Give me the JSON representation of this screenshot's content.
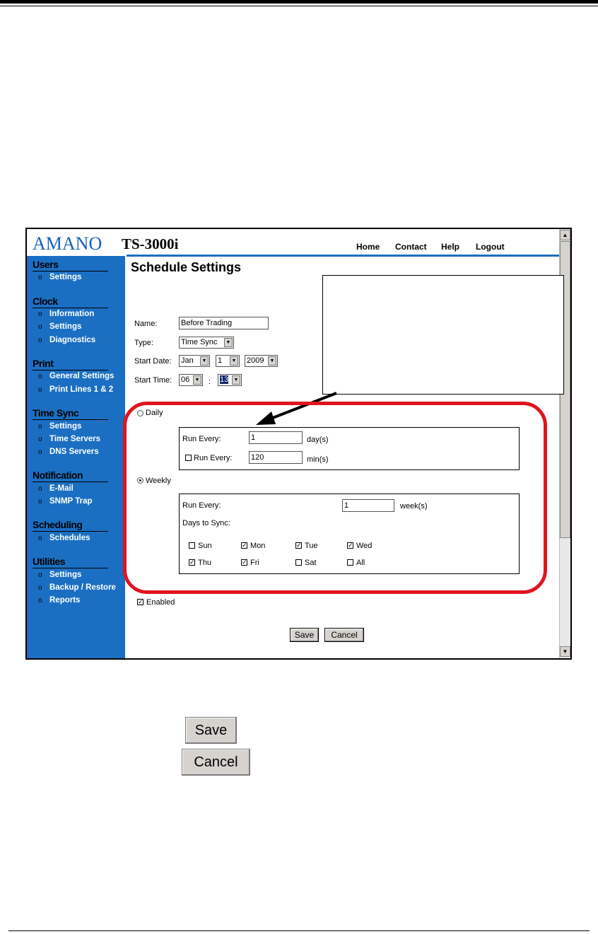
{
  "header": {
    "logo": "AMANO",
    "model": "TS-3000i",
    "nav": [
      "Home",
      "Contact",
      "Help",
      "Logout"
    ]
  },
  "sidebar": {
    "sections": [
      {
        "title": "Users",
        "items": [
          "Settings"
        ]
      },
      {
        "title": "Clock",
        "items": [
          "Information",
          "Settings",
          "Diagnostics"
        ]
      },
      {
        "title": "Print",
        "items": [
          "General Settings",
          "Print Lines 1 & 2"
        ]
      },
      {
        "title": "Time Sync",
        "items": [
          "Settings",
          "Time Servers",
          "DNS Servers"
        ]
      },
      {
        "title": "Notification",
        "items": [
          "E-Mail",
          "SNMP Trap"
        ]
      },
      {
        "title": "Scheduling",
        "items": [
          "Schedules"
        ]
      },
      {
        "title": "Utilities",
        "items": [
          "Settings",
          "Backup / Restore",
          "Reports"
        ]
      }
    ],
    "bullet": "o"
  },
  "page": {
    "title": "Schedule Settings",
    "name_label": "Name:",
    "name_value": "Before Trading",
    "type_label": "Type:",
    "type_value": "Time Sync",
    "start_date_label": "Start Date:",
    "start_month": "Jan",
    "start_day": "1",
    "start_year": "2009",
    "start_time_label": "Start Time:",
    "start_hour": "06",
    "time_sep": ":",
    "start_minute": "13"
  },
  "daily": {
    "label": "Daily",
    "selected": false,
    "run_every_label": "Run Every:",
    "run_every_value": "1",
    "run_every_unit": "day(s)",
    "run_every2_label": "Run Every:",
    "run_every2_checked": false,
    "run_every2_value": "120",
    "run_every2_unit": "min(s)"
  },
  "weekly": {
    "label": "Weekly",
    "selected": true,
    "run_every_label": "Run Every:",
    "run_every_value": "1",
    "run_every_unit": "week(s)",
    "days_label": "Days to Sync:",
    "days": [
      {
        "label": "Sun",
        "checked": false
      },
      {
        "label": "Mon",
        "checked": true
      },
      {
        "label": "Tue",
        "checked": true
      },
      {
        "label": "Wed",
        "checked": true
      },
      {
        "label": "Thu",
        "checked": true
      },
      {
        "label": "Fri",
        "checked": true
      },
      {
        "label": "Sat",
        "checked": false
      },
      {
        "label": "All",
        "checked": false
      }
    ]
  },
  "enabled": {
    "label": "Enabled",
    "checked": true
  },
  "buttons": {
    "save": "Save",
    "cancel": "Cancel"
  },
  "legend_buttons": {
    "save": "Save",
    "cancel": "Cancel"
  },
  "colors": {
    "brand_blue": "#1b6fc2",
    "highlight_red": "#e0141e"
  }
}
